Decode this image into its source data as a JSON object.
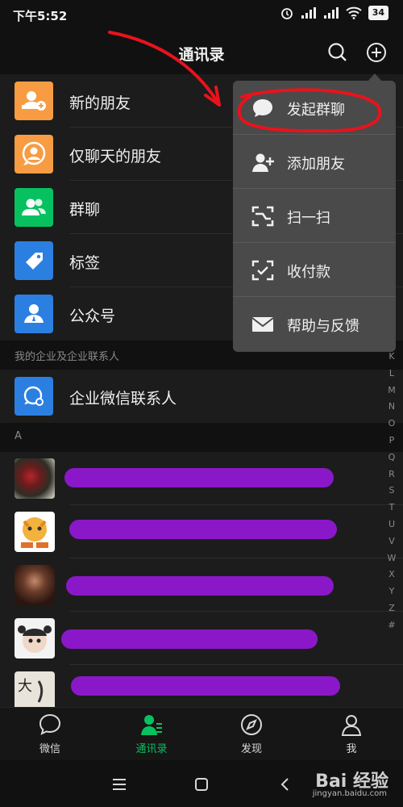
{
  "status": {
    "time": "下午5:52",
    "battery": "34"
  },
  "header": {
    "title": "通讯录"
  },
  "functions": [
    {
      "label": "新的朋友",
      "color": "#f79c42",
      "icon": "add-friend-icon"
    },
    {
      "label": "仅聊天的朋友",
      "color": "#f79c42",
      "icon": "chat-only-icon"
    },
    {
      "label": "群聊",
      "color": "#07c160",
      "icon": "group-icon"
    },
    {
      "label": "标签",
      "color": "#2b7fe0",
      "icon": "tag-icon"
    },
    {
      "label": "公众号",
      "color": "#2b7fe0",
      "icon": "official-account-icon"
    }
  ],
  "enterprise": {
    "section": "我的企业及企业联系人",
    "item": "企业微信联系人",
    "color": "#2b7fe0"
  },
  "contacts_section": "A",
  "index_letters": [
    "K",
    "L",
    "M",
    "N",
    "O",
    "P",
    "Q",
    "R",
    "S",
    "T",
    "U",
    "V",
    "W",
    "X",
    "Y",
    "Z",
    "#"
  ],
  "popup": {
    "items": [
      {
        "label": "发起群聊",
        "icon": "chat-bubble-icon"
      },
      {
        "label": "添加朋友",
        "icon": "add-user-icon"
      },
      {
        "label": "扫一扫",
        "icon": "scan-icon"
      },
      {
        "label": "收付款",
        "icon": "payment-icon"
      },
      {
        "label": "帮助与反馈",
        "icon": "mail-icon"
      }
    ]
  },
  "tabs": [
    {
      "label": "微信",
      "icon": "chat-tab-icon"
    },
    {
      "label": "通讯录",
      "icon": "contacts-tab-icon",
      "active": true
    },
    {
      "label": "发现",
      "icon": "compass-icon"
    },
    {
      "label": "我",
      "icon": "person-icon"
    }
  ],
  "watermark": {
    "brand": "Bai 经验",
    "url": "jingyan.baidu.com"
  },
  "colors": {
    "accent": "#07c160",
    "annotation": "#e8131c",
    "redaction": "#8a18c9"
  }
}
